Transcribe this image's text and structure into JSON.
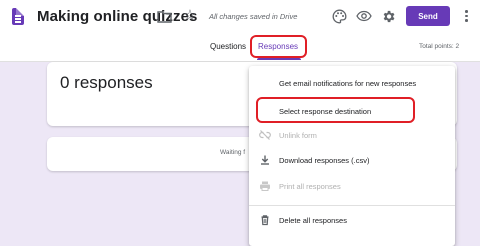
{
  "header": {
    "title": "Making online quizzes",
    "save_status": "All changes saved in Drive",
    "send_label": "Send",
    "icons": [
      "forms-doc-icon",
      "folder-icon",
      "star-icon",
      "palette-icon",
      "eye-icon",
      "gear-icon",
      "more-vert-icon"
    ],
    "accent_color": "#673ab7"
  },
  "tabs": {
    "questions": "Questions",
    "responses": "Responses",
    "total_points": "Total points: 2"
  },
  "main": {
    "responses_count": "0 responses",
    "waiting_text": "Waiting f"
  },
  "menu": {
    "items": [
      {
        "label": "Get email notifications for new responses",
        "icon": "",
        "enabled": true
      },
      {
        "label": "Select response destination",
        "icon": "",
        "enabled": true
      },
      {
        "label": "Unlink form",
        "icon": "link-off-icon",
        "enabled": false
      },
      {
        "label": "Download responses (.csv)",
        "icon": "download-icon",
        "enabled": true
      },
      {
        "label": "Print all responses",
        "icon": "print-icon",
        "enabled": false
      },
      {
        "label": "Delete all responses",
        "icon": "trash-icon",
        "enabled": true
      }
    ]
  },
  "annotation_color": "#e01f26"
}
